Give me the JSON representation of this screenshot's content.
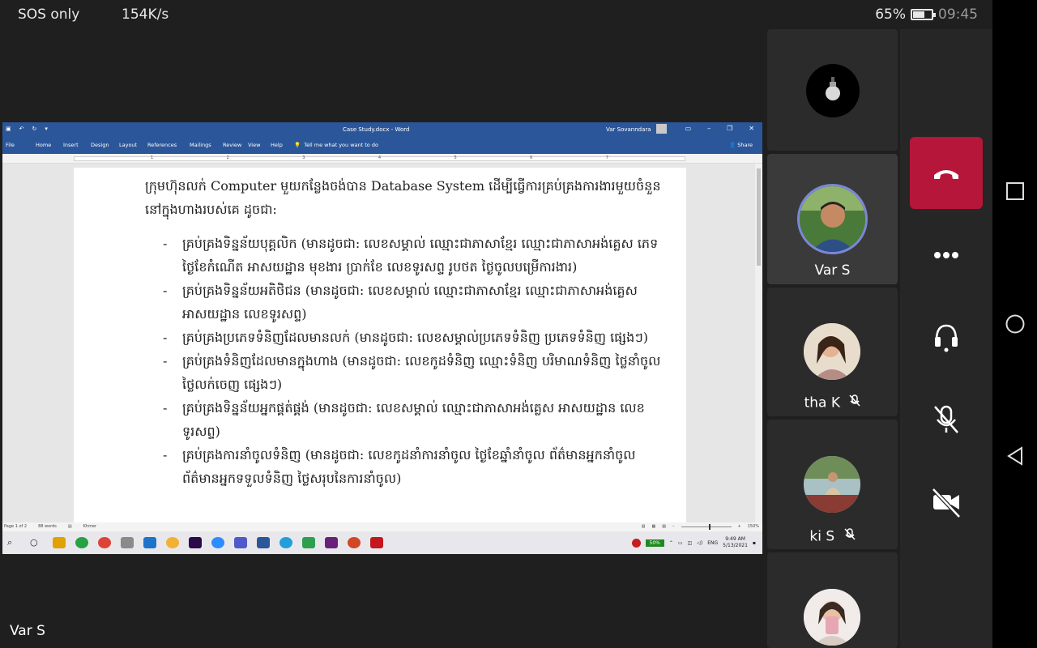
{
  "status_bar": {
    "left_text": "SOS only",
    "speed": "154K/s",
    "battery_percent": "65%",
    "battery_level": 0.65,
    "time": "09:45"
  },
  "word": {
    "title": "Case Study.docx - Word",
    "user": "Var Sovanndara",
    "menu": [
      "File",
      "Home",
      "Insert",
      "Design",
      "Layout",
      "References",
      "Mailings",
      "Review",
      "View",
      "Help"
    ],
    "tell_me": "Tell me what you want to do",
    "share": "Share",
    "ruler_numbers": [
      "1",
      "2",
      "3",
      "4",
      "5",
      "6",
      "7"
    ],
    "doc": {
      "intro": "ក្រុមហ៊ុនលក់ Computer មួយកន្លែងចង់បាន Database System ដើម្បីធ្វើការគ្រប់គ្រងការងារមួយចំនួននៅក្នុងហាងរបស់គេ ដូចជា:",
      "bullets": [
        "គ្រប់គ្រងទិន្នន័យបុគ្គលិក (មានដូចជា: លេខសម្គាល់ ឈ្មោះជាភាសាខ្មែរ ឈ្មោះជាភាសាអង់គ្លេស ភេទ ថ្ងៃខែកំណើត អាសយដ្ឋាន មុខងារ ប្រាក់ខែ លេខទូរសព្ទ រូបថត ថ្ងៃចូលបម្រើការងារ)",
        "គ្រប់គ្រងទិន្នន័យអតិថិជន (មានដូចជា: លេខសម្គាល់ ឈ្មោះជាភាសាខ្មែរ ឈ្មោះជាភាសាអង់គ្លេស អាសយដ្ឋាន លេខទូរសព្ទ)",
        "គ្រប់គ្រងប្រភេទទំនិញដែលមានលក់ (មានដូចជា: លេខសម្គាល់ប្រភេទទំនិញ ប្រភេទទំនិញ ផ្សេងៗ)",
        "គ្រប់គ្រងទំនិញដែលមានក្នុងហាង (មានដូចជា: លេខកូដទំនិញ ឈ្មោះទំនិញ បរិមាណទំនិញ ថ្លៃនាំចូល ថ្លៃលក់ចេញ ផ្សេងៗ)",
        "គ្រប់គ្រងទិន្នន័យអ្នកផ្គត់ផ្គង់ (មានដូចជា: លេខសម្គាល់ ឈ្មោះជាភាសាអង់គ្លេស អាសយដ្ឋាន លេខទូរសព្ទ)",
        "គ្រប់គ្រងការនាំចូលទំនិញ (មានដូចជា: លេខកូដនាំការនាំចូល ថ្ងៃខែឆ្នាំនាំចូល ព័ត៌មានអ្នកនាំចូល ព័ត៌មានអ្នកទទួលទំនិញ ថ្លៃសរុបនៃការនាំចូល)"
      ]
    },
    "status": {
      "page": "Page 1 of 2",
      "words": "88 words",
      "language": "Khmer",
      "zoom": "150%"
    }
  },
  "taskbar": {
    "battery_pill": "50%",
    "lang": "ENG",
    "time": "9:49 AM",
    "date": "5/13/2021"
  },
  "participants": [
    {
      "name": "Var S",
      "muted": false
    },
    {
      "name": "tha K",
      "muted": true
    },
    {
      "name": "ki S",
      "muted": true
    }
  ],
  "footer_name": "Var S",
  "colors": {
    "word_blue": "#2b579a",
    "hangup_red": "#b5163a",
    "tile_bg": "#2b2b2b"
  }
}
